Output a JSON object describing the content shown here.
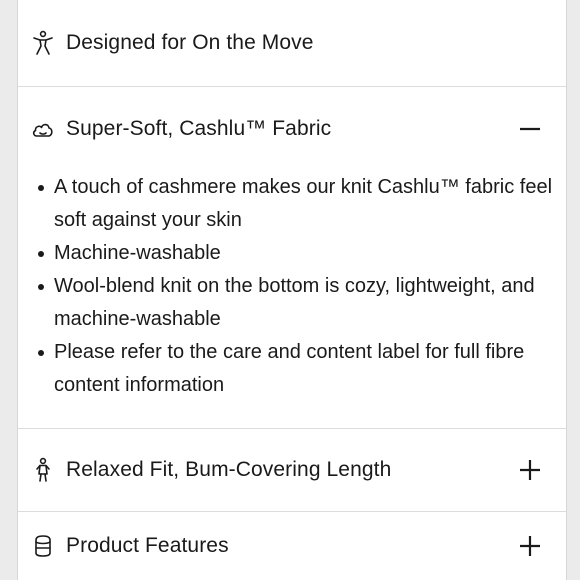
{
  "accordion": {
    "items": [
      {
        "title": "Designed for On the Move",
        "icon": "person-stretch-icon",
        "expanded": false
      },
      {
        "title": "Super-Soft, Cashlu™ Fabric",
        "icon": "cloud-icon",
        "expanded": true,
        "toggle_icon": "minus-icon",
        "bullets": [
          "A touch of cashmere makes our knit Cashlu™ fabric feel soft against your skin",
          "Machine-washable",
          "Wool-blend knit on the bottom is cozy, lightweight, and machine-washable",
          "Please refer to the care and content label for full fibre content information"
        ]
      },
      {
        "title": "Relaxed Fit, Bum-Covering Length",
        "icon": "person-fit-icon",
        "expanded": false,
        "toggle_icon": "plus-icon"
      },
      {
        "title": "Product Features",
        "icon": "features-icon",
        "expanded": false,
        "toggle_icon": "plus-icon"
      }
    ]
  }
}
